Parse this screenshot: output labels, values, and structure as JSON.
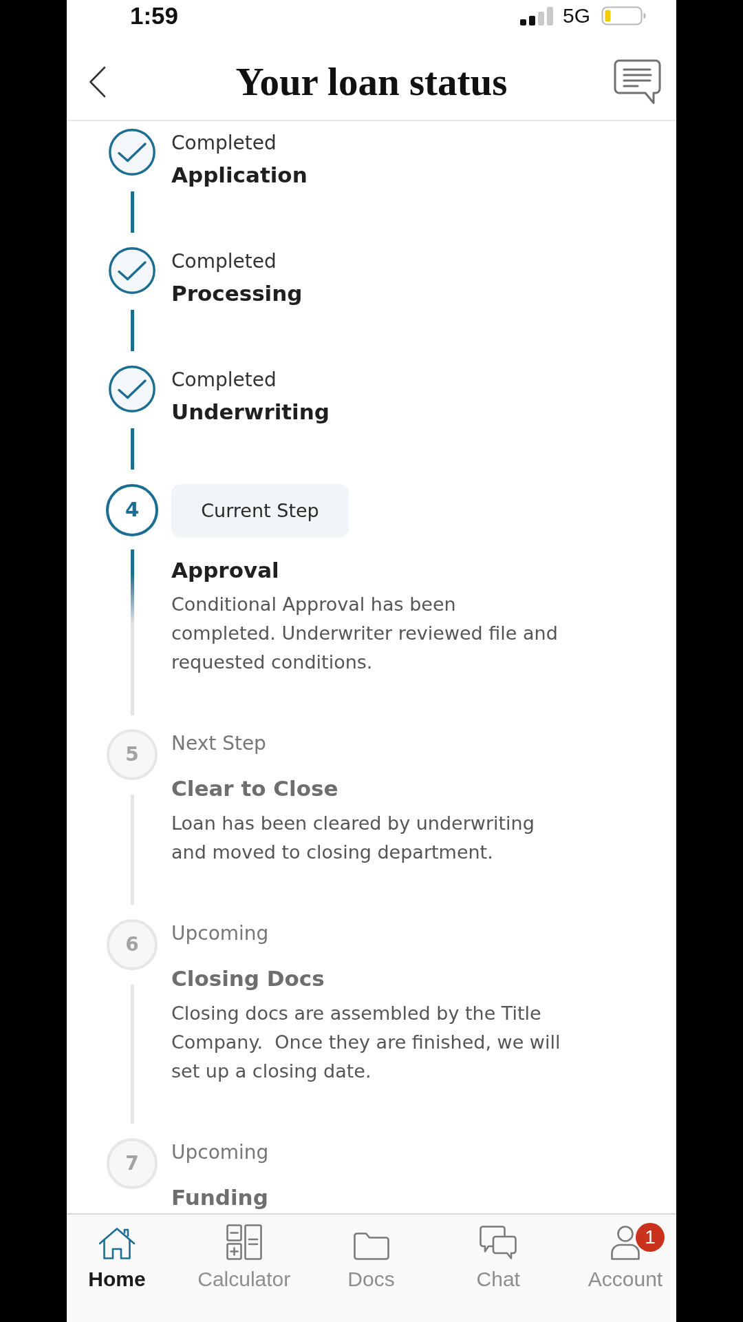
{
  "status_bar": {
    "time": "1:59",
    "network": "5G"
  },
  "header": {
    "title": "Your loan status"
  },
  "steps": [
    {
      "kind": "completed",
      "label": "Completed",
      "title": "Application"
    },
    {
      "kind": "completed",
      "label": "Completed",
      "title": "Processing"
    },
    {
      "kind": "completed",
      "label": "Completed",
      "title": "Underwriting"
    },
    {
      "kind": "current",
      "number": "4",
      "label": "Current Step",
      "title": "Approval",
      "description": "Conditional Approval has been completed. Underwriter reviewed file and requested conditions."
    },
    {
      "kind": "pending",
      "number": "5",
      "label": "Next Step",
      "title": "Clear to Close",
      "description": "Loan has been cleared by underwriting and moved to closing department."
    },
    {
      "kind": "pending",
      "number": "6",
      "label": "Upcoming",
      "title": "Closing Docs",
      "description": "Closing docs are assembled by the Title Company.  Once they are finished, we will set up a closing date."
    },
    {
      "kind": "pending",
      "number": "7",
      "label": "Upcoming",
      "title": "Funding"
    }
  ],
  "tab_bar": {
    "tabs": [
      {
        "label": "Home",
        "selected": true
      },
      {
        "label": "Calculator",
        "selected": false
      },
      {
        "label": "Docs",
        "selected": false
      },
      {
        "label": "Chat",
        "selected": false
      },
      {
        "label": "Account",
        "selected": false,
        "badge": "1"
      }
    ]
  }
}
